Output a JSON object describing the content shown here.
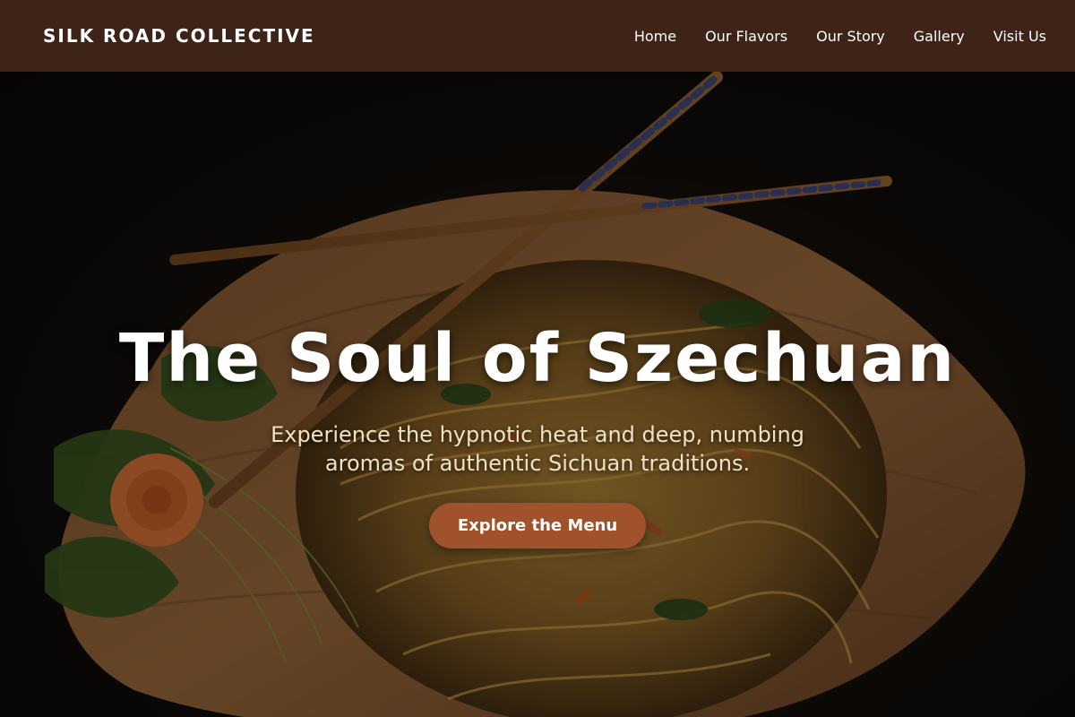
{
  "brand": {
    "name": "SILK ROAD COLLECTIVE"
  },
  "nav": {
    "items": [
      {
        "label": "Home"
      },
      {
        "label": "Our Flavors"
      },
      {
        "label": "Our Story"
      },
      {
        "label": "Gallery"
      },
      {
        "label": "Visit Us"
      }
    ]
  },
  "hero": {
    "title": "The Soul of Szechuan",
    "subtitle": "Experience the hypnotic heat and deep, numbing aromas of authentic Sichuan traditions.",
    "cta_label": "Explore the Menu",
    "image": "noodle-dish-on-wooden-plate-with-chopsticks"
  },
  "colors": {
    "nav_background": "#3e2418",
    "cta_background": "#a0522d",
    "subtitle_text": "#f1e2c4"
  }
}
